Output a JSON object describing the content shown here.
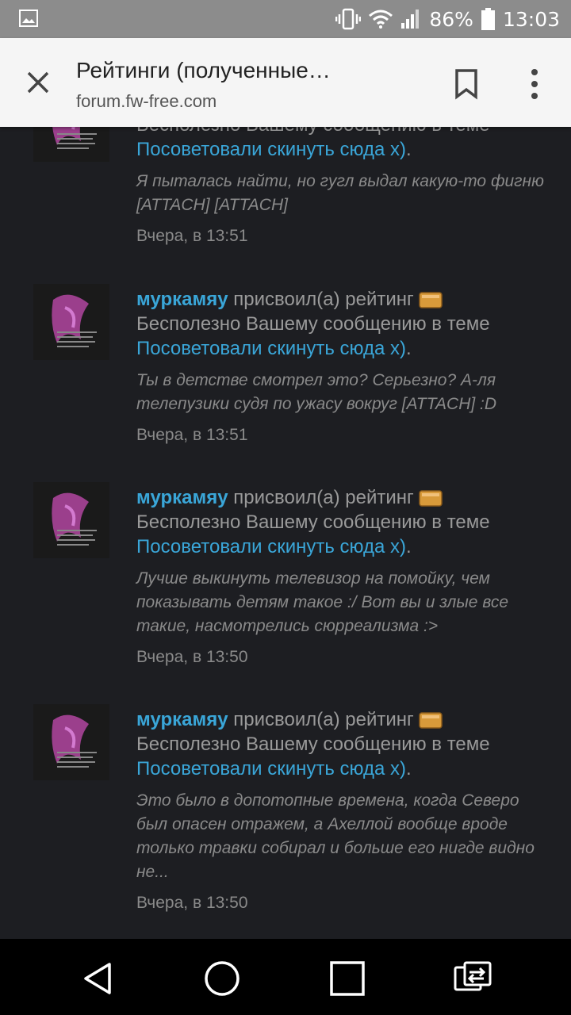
{
  "status_bar": {
    "battery": "86%",
    "time": "13:03",
    "icons": [
      "image-icon",
      "vibrate-icon",
      "wifi-icon",
      "signal-icon",
      "battery-icon"
    ]
  },
  "toolbar": {
    "title": "Рейтинги (полученные…",
    "url": "forum.fw-free.com"
  },
  "colors": {
    "background": "#1d1e22",
    "link": "#3aa6d8",
    "muted": "#9a9a9a"
  },
  "items": [
    {
      "user": "",
      "action": "",
      "rating_text": "Бесполезно Вашему сообщению в теме",
      "thread": "Посоветовали скинуть сюда х)",
      "period": ".",
      "excerpt": "Я пыталась найти, но гугл выдал какую-то фигню [ATTACH] [ATTACH]",
      "time": "Вчера, в 13:51"
    },
    {
      "user": "муркамяу",
      "action": " присвоил(а) рейтинг",
      "rating_text": "Бесполезно Вашему сообщению в теме",
      "thread": "Посоветовали скинуть сюда х)",
      "period": ".",
      "excerpt": "Ты в детстве смотрел это? Серьезно? А-ля телепузики судя по ужасу вокруг [ATTACH] :D",
      "time": "Вчера, в 13:51"
    },
    {
      "user": "муркамяу",
      "action": " присвоил(а) рейтинг",
      "rating_text": "Бесполезно Вашему сообщению в теме",
      "thread": "Посоветовали скинуть сюда х)",
      "period": ".",
      "excerpt": "Лучше выкинуть телевизор на помойку, чем показывать детям такое :/ Вот вы и злые все такие, насмотрелись сюрреализма :>",
      "time": "Вчера, в 13:50"
    },
    {
      "user": "муркамяу",
      "action": " присвоил(а) рейтинг",
      "rating_text": "Бесполезно Вашему сообщению в теме",
      "thread": "Посоветовали скинуть сюда х)",
      "period": ".",
      "excerpt": "Это было в допотопные времена, когда Северо был опасен отражем, а Ахеллой вообще вроде только травки собирал и больше его нигде видно не...",
      "time": "Вчера, в 13:50"
    }
  ],
  "nav_bar": {
    "buttons": [
      "back-icon",
      "home-icon",
      "recents-icon",
      "switch-app-icon"
    ]
  }
}
